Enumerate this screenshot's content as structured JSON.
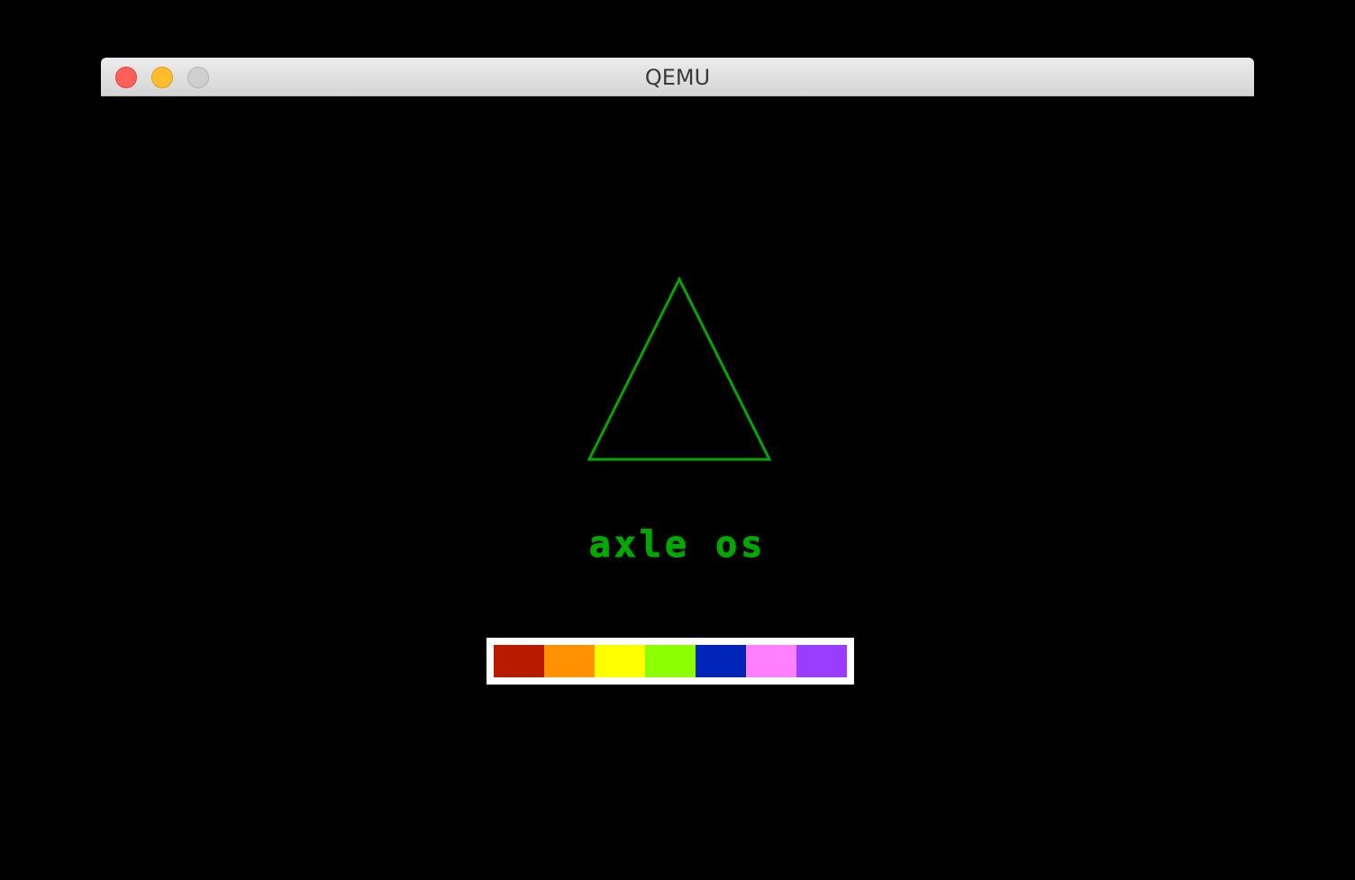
{
  "window": {
    "title": "QEMU"
  },
  "boot_screen": {
    "os_name": "axle os",
    "logo_color": "#00a800",
    "progress_colors": [
      "#b81a00",
      "#ff9200",
      "#ffff00",
      "#8cff00",
      "#0023b8",
      "#ff80ff",
      "#9a3dff"
    ]
  }
}
